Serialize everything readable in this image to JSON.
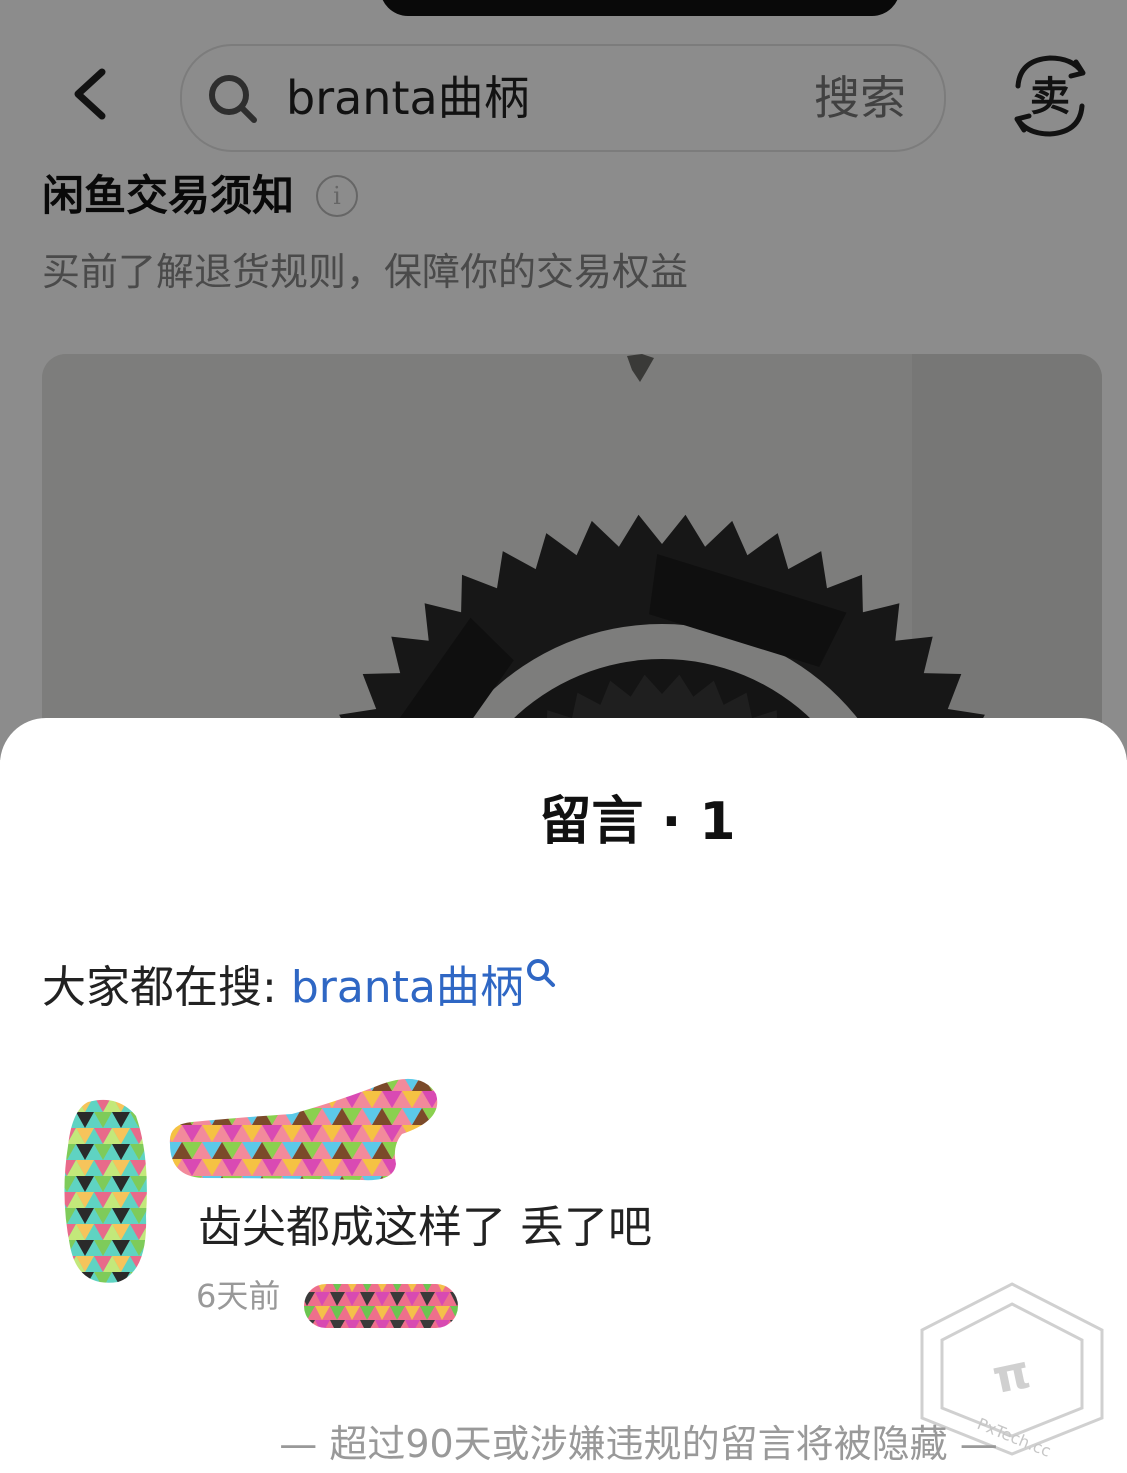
{
  "search": {
    "query": "branta曲柄",
    "button_label": "搜索"
  },
  "header": {
    "sell_label": "卖"
  },
  "notice": {
    "title": "闲鱼交易须知",
    "subtitle": "买前了解退货规则，保障你的交易权益"
  },
  "sheet": {
    "title": "留言 · 1",
    "trending_label": "大家都在搜:",
    "trending_term": "branta曲柄",
    "footer": "— 超过90天或涉嫌违规的留言将被隐藏 —"
  },
  "comments": [
    {
      "text": "齿尖都成这样了 丢了吧",
      "time": "6天前"
    }
  ],
  "watermark_text": "PxTech.cc",
  "colors": {
    "link": "#2f67c4",
    "overlay": "rgba(0,0,0,0.45)",
    "sheet_bg": "#ffffff"
  }
}
